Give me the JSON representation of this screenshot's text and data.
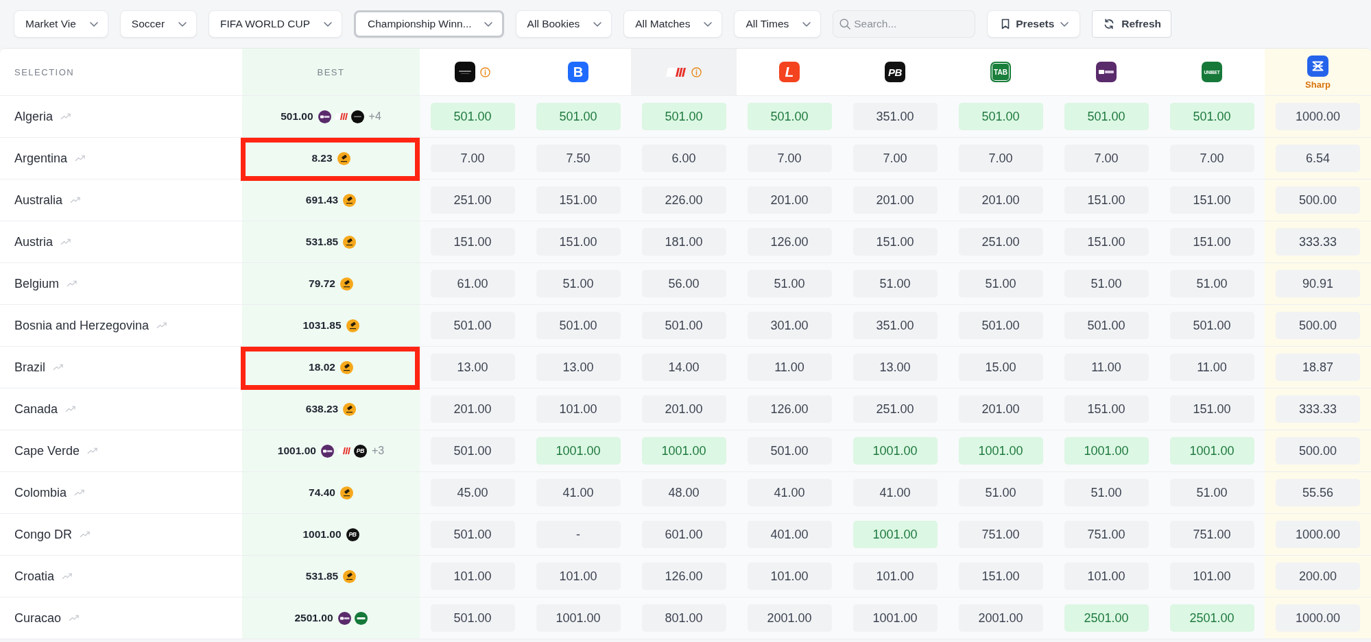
{
  "toolbar": {
    "filters": [
      {
        "label": "Market Vie",
        "focused": false
      },
      {
        "label": "Soccer",
        "focused": false
      },
      {
        "label": "FIFA WORLD CUP",
        "focused": false
      },
      {
        "label": "Championship Winn...",
        "focused": true
      },
      {
        "label": "All Bookies",
        "focused": false
      },
      {
        "label": "All Matches",
        "focused": false
      },
      {
        "label": "All Times",
        "focused": false
      }
    ],
    "search": {
      "placeholder": "Search..."
    },
    "presets_button": {
      "label": "Presets"
    },
    "refresh_button": {
      "label": "Refresh"
    }
  },
  "table": {
    "columns": {
      "selection": "SELECTION",
      "best": "BEST",
      "bookies": [
        {
          "kind": "dark",
          "info": true,
          "highlighted": false
        },
        {
          "kind": "bee",
          "logo_text": "B",
          "info": false,
          "highlighted": false
        },
        {
          "kind": "stripes",
          "info": true,
          "highlighted": true
        },
        {
          "kind": "ell",
          "logo_text": "L",
          "info": false,
          "highlighted": false
        },
        {
          "kind": "pb",
          "logo_text": "PB",
          "info": false,
          "highlighted": false
        },
        {
          "kind": "tab",
          "logo_text": "TAB",
          "info": false,
          "highlighted": false
        },
        {
          "kind": "touch",
          "info": false,
          "highlighted": false
        },
        {
          "kind": "unibet",
          "logo_text": "UNIBET",
          "info": false,
          "highlighted": false
        }
      ],
      "sharp": {
        "kind": "sharp",
        "label": "Sharp"
      }
    },
    "rows": [
      {
        "selection": "Algeria",
        "best": {
          "value": "501.00",
          "sources": [
            {
              "kind": "touch"
            },
            {
              "kind": "stripes"
            },
            {
              "kind": "dark"
            }
          ],
          "more": "+4",
          "annotated": false
        },
        "odds": [
          {
            "value": "501.00",
            "best": true
          },
          {
            "value": "501.00",
            "best": true
          },
          {
            "value": "501.00",
            "best": true
          },
          {
            "value": "501.00",
            "best": true
          },
          {
            "value": "351.00",
            "best": false
          },
          {
            "value": "501.00",
            "best": true
          },
          {
            "value": "501.00",
            "best": true
          },
          {
            "value": "501.00",
            "best": true
          }
        ],
        "sharp": "1000.00"
      },
      {
        "selection": "Argentina",
        "best": {
          "value": "8.23",
          "sources": [
            {
              "kind": "coin"
            }
          ],
          "annotated": true
        },
        "odds": [
          {
            "value": "7.00",
            "best": false
          },
          {
            "value": "7.50",
            "best": false
          },
          {
            "value": "6.00",
            "best": false
          },
          {
            "value": "7.00",
            "best": false
          },
          {
            "value": "7.00",
            "best": false
          },
          {
            "value": "7.00",
            "best": false
          },
          {
            "value": "7.00",
            "best": false
          },
          {
            "value": "7.00",
            "best": false
          }
        ],
        "sharp": "6.54"
      },
      {
        "selection": "Australia",
        "best": {
          "value": "691.43",
          "sources": [
            {
              "kind": "coin"
            }
          ],
          "annotated": false
        },
        "odds": [
          {
            "value": "251.00",
            "best": false
          },
          {
            "value": "151.00",
            "best": false
          },
          {
            "value": "226.00",
            "best": false
          },
          {
            "value": "201.00",
            "best": false
          },
          {
            "value": "201.00",
            "best": false
          },
          {
            "value": "201.00",
            "best": false
          },
          {
            "value": "151.00",
            "best": false
          },
          {
            "value": "151.00",
            "best": false
          }
        ],
        "sharp": "500.00"
      },
      {
        "selection": "Austria",
        "best": {
          "value": "531.85",
          "sources": [
            {
              "kind": "coin"
            }
          ],
          "annotated": false
        },
        "odds": [
          {
            "value": "151.00",
            "best": false
          },
          {
            "value": "151.00",
            "best": false
          },
          {
            "value": "181.00",
            "best": false
          },
          {
            "value": "126.00",
            "best": false
          },
          {
            "value": "151.00",
            "best": false
          },
          {
            "value": "251.00",
            "best": false
          },
          {
            "value": "151.00",
            "best": false
          },
          {
            "value": "151.00",
            "best": false
          }
        ],
        "sharp": "333.33"
      },
      {
        "selection": "Belgium",
        "best": {
          "value": "79.72",
          "sources": [
            {
              "kind": "coin"
            }
          ],
          "annotated": false
        },
        "odds": [
          {
            "value": "61.00",
            "best": false
          },
          {
            "value": "51.00",
            "best": false
          },
          {
            "value": "56.00",
            "best": false
          },
          {
            "value": "51.00",
            "best": false
          },
          {
            "value": "51.00",
            "best": false
          },
          {
            "value": "51.00",
            "best": false
          },
          {
            "value": "51.00",
            "best": false
          },
          {
            "value": "51.00",
            "best": false
          }
        ],
        "sharp": "90.91"
      },
      {
        "selection": "Bosnia and Herzegovina",
        "best": {
          "value": "1031.85",
          "sources": [
            {
              "kind": "coin"
            }
          ],
          "annotated": false
        },
        "odds": [
          {
            "value": "501.00",
            "best": false
          },
          {
            "value": "501.00",
            "best": false
          },
          {
            "value": "501.00",
            "best": false
          },
          {
            "value": "301.00",
            "best": false
          },
          {
            "value": "351.00",
            "best": false
          },
          {
            "value": "501.00",
            "best": false
          },
          {
            "value": "501.00",
            "best": false
          },
          {
            "value": "501.00",
            "best": false
          }
        ],
        "sharp": "500.00"
      },
      {
        "selection": "Brazil",
        "best": {
          "value": "18.02",
          "sources": [
            {
              "kind": "coin"
            }
          ],
          "annotated": true
        },
        "odds": [
          {
            "value": "13.00",
            "best": false
          },
          {
            "value": "13.00",
            "best": false
          },
          {
            "value": "14.00",
            "best": false
          },
          {
            "value": "11.00",
            "best": false
          },
          {
            "value": "13.00",
            "best": false
          },
          {
            "value": "15.00",
            "best": false
          },
          {
            "value": "11.00",
            "best": false
          },
          {
            "value": "11.00",
            "best": false
          }
        ],
        "sharp": "18.87"
      },
      {
        "selection": "Canada",
        "best": {
          "value": "638.23",
          "sources": [
            {
              "kind": "coin"
            }
          ],
          "annotated": false
        },
        "odds": [
          {
            "value": "201.00",
            "best": false
          },
          {
            "value": "101.00",
            "best": false
          },
          {
            "value": "201.00",
            "best": false
          },
          {
            "value": "126.00",
            "best": false
          },
          {
            "value": "251.00",
            "best": false
          },
          {
            "value": "201.00",
            "best": false
          },
          {
            "value": "151.00",
            "best": false
          },
          {
            "value": "151.00",
            "best": false
          }
        ],
        "sharp": "333.33"
      },
      {
        "selection": "Cape Verde",
        "best": {
          "value": "1001.00",
          "sources": [
            {
              "kind": "touch"
            },
            {
              "kind": "stripes"
            },
            {
              "kind": "pb",
              "text": "PB"
            }
          ],
          "more": "+3",
          "annotated": false
        },
        "odds": [
          {
            "value": "501.00",
            "best": false
          },
          {
            "value": "1001.00",
            "best": true
          },
          {
            "value": "1001.00",
            "best": true
          },
          {
            "value": "501.00",
            "best": false
          },
          {
            "value": "1001.00",
            "best": true
          },
          {
            "value": "1001.00",
            "best": true
          },
          {
            "value": "1001.00",
            "best": true
          },
          {
            "value": "1001.00",
            "best": true
          }
        ],
        "sharp": "500.00"
      },
      {
        "selection": "Colombia",
        "best": {
          "value": "74.40",
          "sources": [
            {
              "kind": "coin"
            }
          ],
          "annotated": false
        },
        "odds": [
          {
            "value": "45.00",
            "best": false
          },
          {
            "value": "41.00",
            "best": false
          },
          {
            "value": "48.00",
            "best": false
          },
          {
            "value": "41.00",
            "best": false
          },
          {
            "value": "41.00",
            "best": false
          },
          {
            "value": "51.00",
            "best": false
          },
          {
            "value": "51.00",
            "best": false
          },
          {
            "value": "51.00",
            "best": false
          }
        ],
        "sharp": "55.56"
      },
      {
        "selection": "Congo DR",
        "best": {
          "value": "1001.00",
          "sources": [
            {
              "kind": "pb",
              "text": "PB"
            }
          ],
          "annotated": false
        },
        "odds": [
          {
            "value": "501.00",
            "best": false
          },
          {
            "value": "-",
            "best": false
          },
          {
            "value": "601.00",
            "best": false
          },
          {
            "value": "401.00",
            "best": false
          },
          {
            "value": "1001.00",
            "best": true
          },
          {
            "value": "751.00",
            "best": false
          },
          {
            "value": "751.00",
            "best": false
          },
          {
            "value": "751.00",
            "best": false
          }
        ],
        "sharp": "1000.00"
      },
      {
        "selection": "Croatia",
        "best": {
          "value": "531.85",
          "sources": [
            {
              "kind": "coin"
            }
          ],
          "annotated": false
        },
        "odds": [
          {
            "value": "101.00",
            "best": false
          },
          {
            "value": "101.00",
            "best": false
          },
          {
            "value": "126.00",
            "best": false
          },
          {
            "value": "101.00",
            "best": false
          },
          {
            "value": "101.00",
            "best": false
          },
          {
            "value": "151.00",
            "best": false
          },
          {
            "value": "101.00",
            "best": false
          },
          {
            "value": "101.00",
            "best": false
          }
        ],
        "sharp": "200.00"
      },
      {
        "selection": "Curacao",
        "best": {
          "value": "2501.00",
          "sources": [
            {
              "kind": "touch"
            },
            {
              "kind": "unibet"
            }
          ],
          "annotated": false
        },
        "odds": [
          {
            "value": "501.00",
            "best": false
          },
          {
            "value": "1001.00",
            "best": false
          },
          {
            "value": "801.00",
            "best": false
          },
          {
            "value": "2001.00",
            "best": false
          },
          {
            "value": "1001.00",
            "best": false
          },
          {
            "value": "2001.00",
            "best": false
          },
          {
            "value": "2501.00",
            "best": true
          },
          {
            "value": "2501.00",
            "best": true
          }
        ],
        "sharp": "1000.00"
      }
    ]
  }
}
